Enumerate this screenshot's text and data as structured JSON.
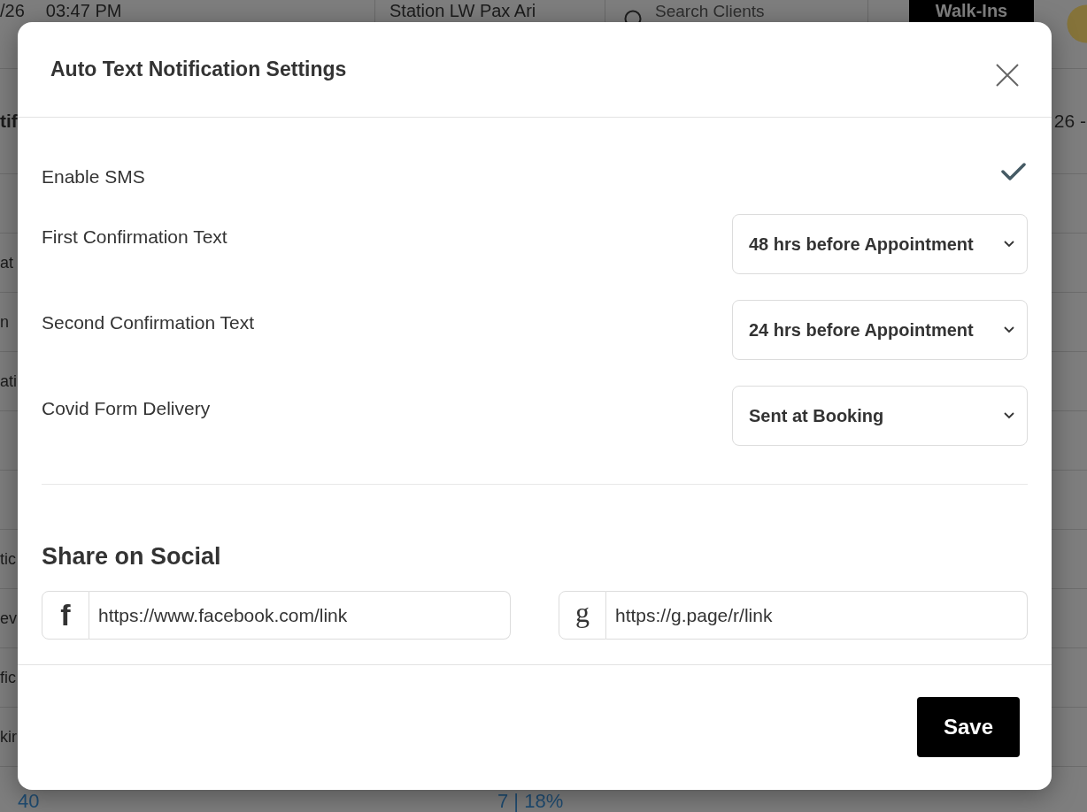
{
  "background_page": {
    "top_bar": {
      "date": "/26",
      "time": "03:47 PM",
      "station": "Station LW Pax Ari",
      "search": {
        "placeholder": "Search Clients"
      },
      "walk_ins_button": "Walk-Ins"
    },
    "heading": "tif",
    "date_range": "26 -",
    "rows": [
      {},
      {
        "column_1": "at"
      },
      {
        "column_1": "n"
      },
      {
        "column_1": "ati"
      },
      {},
      {},
      {
        "column_1": "tic"
      },
      {
        "column_1": "ev"
      },
      {
        "column_1": "fic"
      },
      {
        "column_1": "kir"
      },
      {
        "column_2": "40",
        "column_3": "7 | 18%"
      }
    ]
  },
  "dialog": {
    "title": "Auto Text Notification Settings",
    "enable_sms": {
      "label": "Enable SMS",
      "checked": true
    },
    "settings": [
      {
        "label": "First Confirmation Text",
        "value": "48 hrs before Appointment"
      },
      {
        "label": "Second Confirmation Text",
        "value": "24 hrs before Appointment"
      },
      {
        "label": "Covid Form Delivery",
        "value": "Sent at Booking"
      }
    ],
    "social": {
      "title": "Share on Social",
      "links": [
        {
          "kind": "facebook",
          "icon": "f",
          "url": "https://www.facebook.com/link"
        },
        {
          "kind": "google",
          "icon": "g",
          "url": "https://g.page/r/link"
        }
      ]
    },
    "save_button": "Save"
  }
}
